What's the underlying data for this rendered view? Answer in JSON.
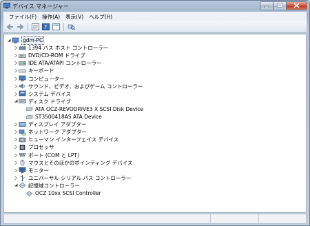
{
  "window": {
    "title": "デバイス マネージャー"
  },
  "menu": [
    "ファイル(F)",
    "操作(A)",
    "表示(V)",
    "ヘルプ(H)"
  ],
  "toolbar": {
    "icons": [
      "back-arrow-icon",
      "forward-arrow-icon",
      "properties-icon",
      "help-icon",
      "view-icon",
      "scan-hardware-icon"
    ]
  },
  "tree": {
    "root": "gdm-PC",
    "categories": [
      {
        "label": "1394 バス ホスト コントローラー",
        "icon": "bus-controller-icon",
        "expanded": false
      },
      {
        "label": "DVD/CD-ROM ドライブ",
        "icon": "dvd-drive-icon",
        "expanded": false
      },
      {
        "label": "IDE ATA/ATAPI コントローラー",
        "icon": "ide-controller-icon",
        "expanded": false
      },
      {
        "label": "キーボード",
        "icon": "keyboard-icon",
        "expanded": false
      },
      {
        "label": "コンピューター",
        "icon": "computer-icon",
        "expanded": false
      },
      {
        "label": "サウンド、ビデオ、およびゲーム コントローラー",
        "icon": "sound-icon",
        "expanded": false
      },
      {
        "label": "システム デバイス",
        "icon": "system-device-icon",
        "expanded": false
      },
      {
        "label": "ディスク ドライブ",
        "icon": "disk-drive-icon",
        "expanded": true,
        "children": [
          "ATA OCZ-REVODRIVE3 X SCSI Disk Device",
          "ST3500418AS ATA Device"
        ]
      },
      {
        "label": "ディスプレイ アダプター",
        "icon": "display-adapter-icon",
        "expanded": false
      },
      {
        "label": "ネットワーク アダプター",
        "icon": "network-adapter-icon",
        "expanded": false
      },
      {
        "label": "ヒューマン インターフェイス デバイス",
        "icon": "hid-icon",
        "expanded": false
      },
      {
        "label": "プロセッサ",
        "icon": "processor-icon",
        "expanded": false
      },
      {
        "label": "ポート (COM と LPT)",
        "icon": "port-icon",
        "expanded": false
      },
      {
        "label": "マウスとそのほかのポインティング デバイス",
        "icon": "mouse-icon",
        "expanded": false
      },
      {
        "label": "モニター",
        "icon": "monitor-icon",
        "expanded": false
      },
      {
        "label": "ユニバーサル シリアル バス コントローラー",
        "icon": "usb-icon",
        "expanded": false
      },
      {
        "label": "記憶域コントローラー",
        "icon": "storage-controller-icon",
        "expanded": true,
        "children": [
          "OCZ 10xx SCSI Controller"
        ]
      }
    ]
  },
  "colors": {
    "titlebar": "#9fb3cb",
    "close_button": "#c03a22",
    "selection": "#e8eef7"
  }
}
